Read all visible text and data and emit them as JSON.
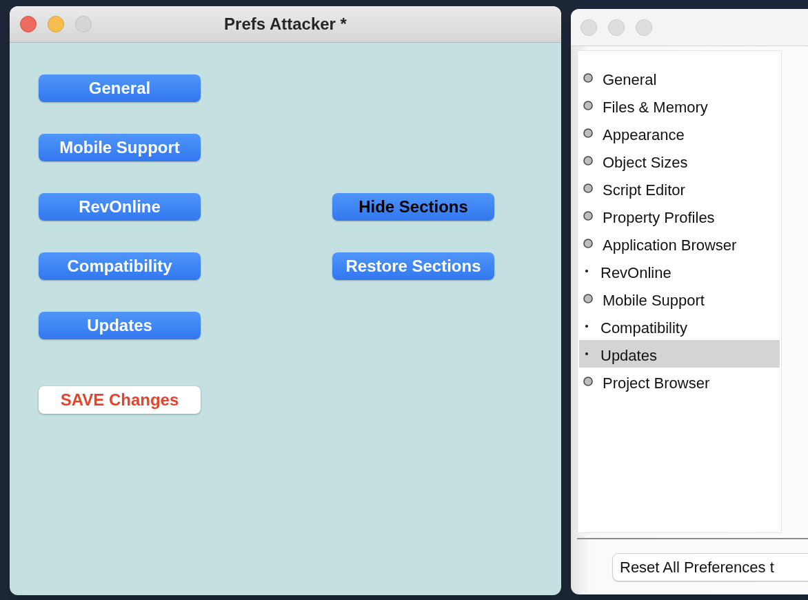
{
  "prefs_window": {
    "title": "Prefs Attacker *",
    "window_buttons": [
      {
        "kind": "close",
        "disabled": false
      },
      {
        "kind": "minimize",
        "disabled": false
      },
      {
        "kind": "zoom",
        "disabled": true
      }
    ],
    "section_buttons": [
      {
        "label": "General"
      },
      {
        "label": "Mobile Support"
      },
      {
        "label": "RevOnline"
      },
      {
        "label": "Compatibility"
      },
      {
        "label": "Updates"
      }
    ],
    "action_buttons": [
      {
        "label": "Hide Sections",
        "kind": "dark"
      },
      {
        "label": "Restore Sections",
        "kind": "light"
      }
    ],
    "save_button": {
      "label": "SAVE Changes"
    }
  },
  "preferences_window": {
    "active": false,
    "sections": [
      {
        "label": "General",
        "kind": "circle",
        "selected": false
      },
      {
        "label": "Files & Memory",
        "kind": "circle",
        "selected": false
      },
      {
        "label": "Appearance",
        "kind": "circle",
        "selected": false
      },
      {
        "label": "Object Sizes",
        "kind": "circle",
        "selected": false
      },
      {
        "label": "Script Editor",
        "kind": "circle",
        "selected": false
      },
      {
        "label": "Property Profiles",
        "kind": "circle",
        "selected": false
      },
      {
        "label": "Application Browser",
        "kind": "circle",
        "selected": false
      },
      {
        "label": "RevOnline",
        "kind": "dot",
        "selected": false
      },
      {
        "label": "Mobile Support",
        "kind": "circle",
        "selected": false
      },
      {
        "label": "Compatibility",
        "kind": "dot",
        "selected": false
      },
      {
        "label": "Updates",
        "kind": "dot",
        "selected": true
      },
      {
        "label": "Project Browser",
        "kind": "circle",
        "selected": false
      }
    ],
    "reset_button": {
      "label": "Reset All Preferences t"
    }
  }
}
